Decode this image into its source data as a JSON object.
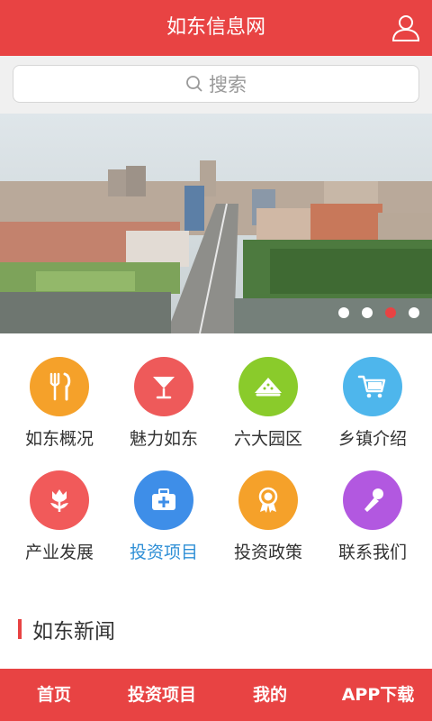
{
  "header": {
    "title": "如东信息网"
  },
  "search": {
    "placeholder": "搜索"
  },
  "banner": {
    "slide_count": 4,
    "active_index": 2
  },
  "grid": [
    {
      "label": "如东概况",
      "icon": "fork-knife-icon",
      "color": "#f5a12a"
    },
    {
      "label": "魅力如东",
      "icon": "cocktail-glass-icon",
      "color": "#ee5a5a"
    },
    {
      "label": "六大园区",
      "icon": "watermelon-icon",
      "color": "#8acb2b"
    },
    {
      "label": "乡镇介绍",
      "icon": "shopping-cart-icon",
      "color": "#4eb6ec"
    },
    {
      "label": "产业发展",
      "icon": "tulip-icon",
      "color": "#f15a5a"
    },
    {
      "label": "投资项目",
      "icon": "medical-kit-icon",
      "color": "#3e8ee8"
    },
    {
      "label": "投资政策",
      "icon": "medal-icon",
      "color": "#f5a12a"
    },
    {
      "label": "联系我们",
      "icon": "microphone-icon",
      "color": "#b258e0"
    }
  ],
  "news": {
    "title": "如东新闻"
  },
  "bottom_nav": [
    {
      "label": "首页"
    },
    {
      "label": "投资项目"
    },
    {
      "label": "我的"
    },
    {
      "label": "APP下载"
    }
  ],
  "colors": {
    "brand": "#e84343",
    "link": "#2f8fd6"
  }
}
